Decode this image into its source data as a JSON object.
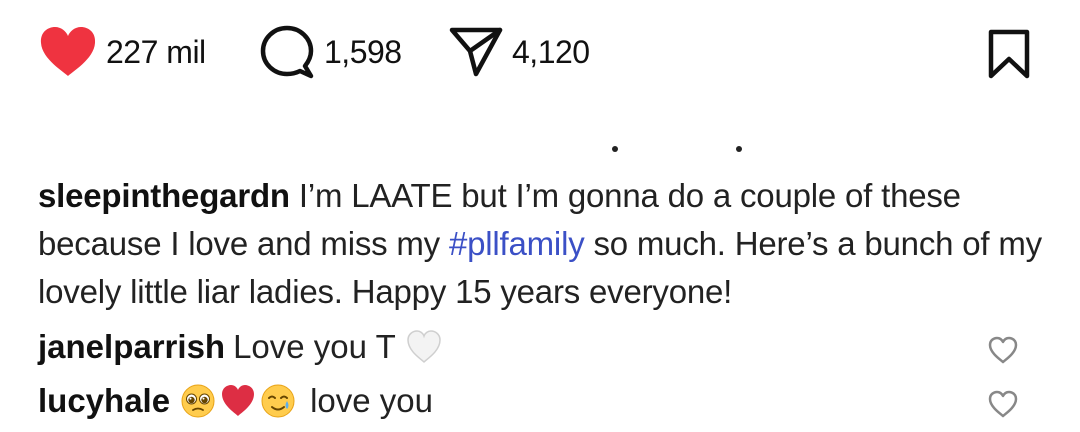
{
  "actions": {
    "likes": "227 mil",
    "comments": "1,598",
    "shares": "4,120"
  },
  "colors": {
    "like_heart": "#ef3340",
    "hashtag": "#3b50c6",
    "text": "#222222"
  },
  "icons": {
    "like": "heart-icon",
    "comment": "speech-bubble-icon",
    "share": "paper-plane-icon",
    "save": "bookmark-icon",
    "comment_like": "heart-outline-icon"
  },
  "caption": {
    "username": "sleepinthegardn",
    "text_before": " I’m LAATE but I’m gonna do a couple of these because I love and miss my ",
    "hashtag": "#pllfamily",
    "text_after": " so much. Here’s a bunch of my lovely little liar ladies. Happy 15 years everyone!"
  },
  "comments": [
    {
      "username": "janelparrish",
      "text": "Love you T",
      "emojis": [
        "white-heart"
      ]
    },
    {
      "username": "lucyhale",
      "text": "love you",
      "emojis": [
        "pleading-face",
        "red-heart",
        "smiling-tear-face"
      ]
    }
  ]
}
